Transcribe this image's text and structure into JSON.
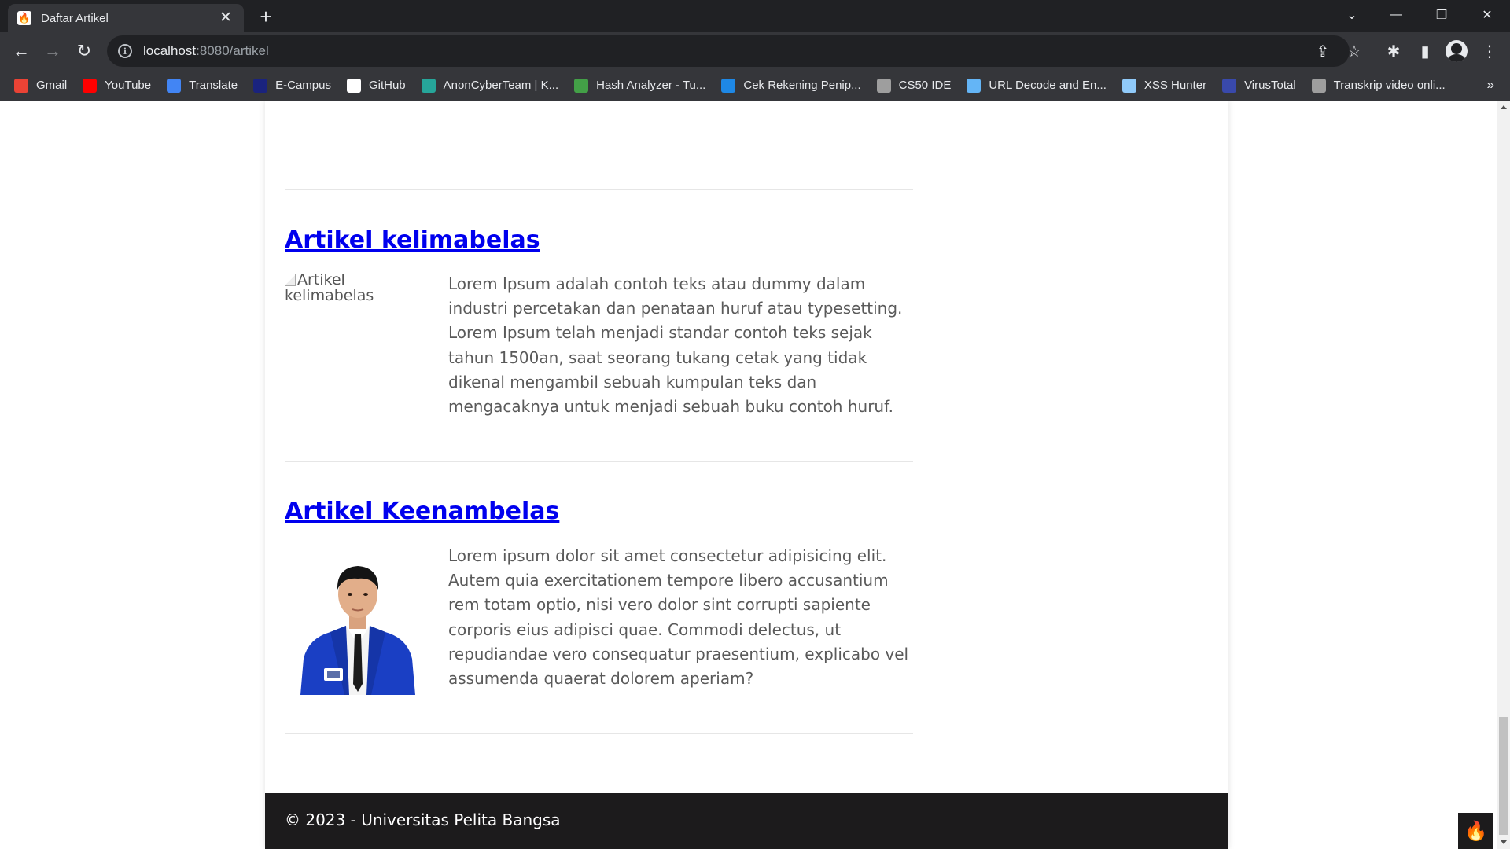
{
  "browser": {
    "tab": {
      "title": "Daftar Artikel",
      "favicon": "codeigniter-flame-icon"
    },
    "url": {
      "host": "localhost",
      "rest": ":8080/artikel"
    },
    "bookmarks": [
      {
        "label": "Gmail",
        "icon": "gmail-icon",
        "color": "#ea4335"
      },
      {
        "label": "YouTube",
        "icon": "youtube-icon",
        "color": "#ff0000"
      },
      {
        "label": "Translate",
        "icon": "google-translate-icon",
        "color": "#4285f4"
      },
      {
        "label": "E-Campus",
        "icon": "e-campus-icon",
        "color": "#1a237e"
      },
      {
        "label": "GitHub",
        "icon": "github-icon",
        "color": "#ffffff"
      },
      {
        "label": "AnonCyberTeam | K...",
        "icon": "anoncyberteam-icon",
        "color": "#26a69a"
      },
      {
        "label": "Hash Analyzer - Tu...",
        "icon": "hash-analyzer-icon",
        "color": "#43a047"
      },
      {
        "label": "Cek Rekening Penip...",
        "icon": "check-badge-icon",
        "color": "#1e88e5"
      },
      {
        "label": "CS50 IDE",
        "icon": "globe-icon",
        "color": "#9e9e9e"
      },
      {
        "label": "URL Decode and En...",
        "icon": "url-icon",
        "color": "#64b5f6"
      },
      {
        "label": "XSS Hunter",
        "icon": "xss-hunter-icon",
        "color": "#90caf9"
      },
      {
        "label": "VirusTotal",
        "icon": "virustotal-icon",
        "color": "#3949ab"
      },
      {
        "label": "Transkrip video onli...",
        "icon": "transcript-icon",
        "color": "#9e9e9e"
      }
    ]
  },
  "articles": [
    {
      "title": "Artikel kelimabelas",
      "image_alt": "Artikel kelimabelas",
      "body": "Lorem Ipsum adalah contoh teks atau dummy dalam industri percetakan dan penataan huruf atau typesetting. Lorem Ipsum telah menjadi standar contoh teks sejak tahun 1500an, saat seorang tukang cetak yang tidak dikenal mengambil sebuah kumpulan teks dan mengacaknya untuk menjadi sebuah buku contoh huruf."
    },
    {
      "title": "Artikel Keenambelas",
      "image": "student-portrait-blue-jacket",
      "body": "Lorem ipsum dolor sit amet consectetur adipisicing elit. Autem quia exercitationem tempore libero accusantium rem totam optio, nisi vero dolor sint corrupti sapiente corporis eius adipisci quae. Commodi delectus, ut repudiandae vero consequatur praesentium, explicabo vel assumenda quaerat dolorem aperiam?"
    }
  ],
  "footer": {
    "text": "© 2023 - Universitas Pelita Bangsa"
  },
  "colors": {
    "link": "#0000ee",
    "footer_bg": "#1c1b1c",
    "body_text": "#5a5a5a"
  }
}
